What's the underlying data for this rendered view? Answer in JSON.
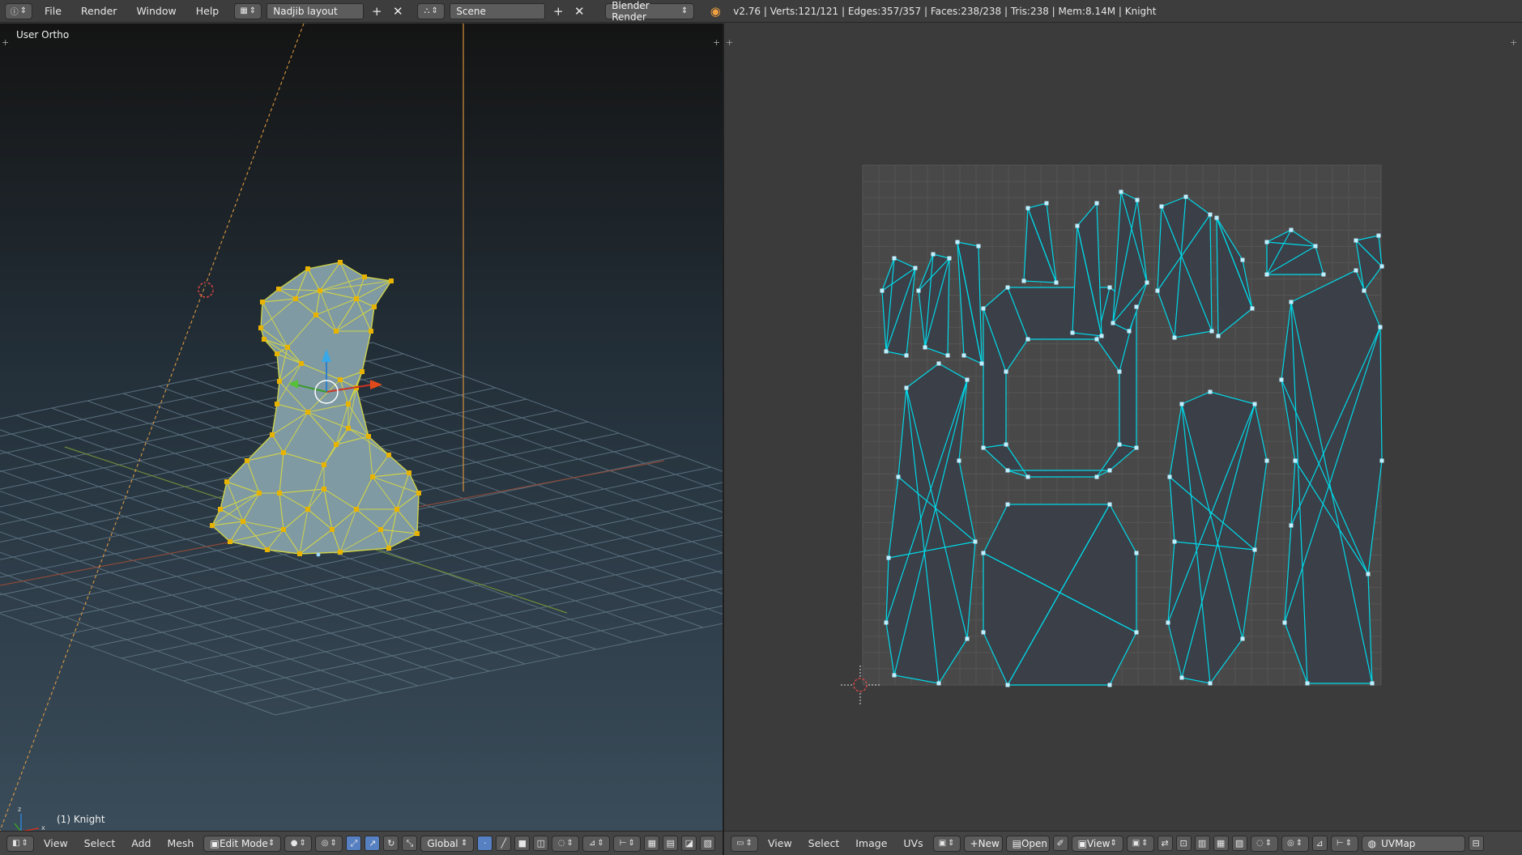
{
  "topbar": {
    "info_icon": "info-icon",
    "menu": [
      "File",
      "Render",
      "Window",
      "Help"
    ],
    "layout_name": "Nadjib layout",
    "scene_name": "Scene",
    "render_engine": "Blender Render",
    "stats": "v2.76 | Verts:121/121 | Edges:357/357 | Faces:238/238 | Tris:238 | Mem:8.14M | Knight"
  },
  "viewport3d": {
    "view_label": "User Ortho",
    "object_label": "(1) Knight",
    "mode": "Edit Mode",
    "orientation": "Global",
    "menu": [
      "View",
      "Select",
      "Add",
      "Mesh"
    ]
  },
  "uv_editor": {
    "menu": [
      "View",
      "Select",
      "Image",
      "UVs"
    ],
    "new_label": "New",
    "open_label": "Open",
    "view_label": "View",
    "uvmap_name": "UVMap"
  },
  "colors": {
    "accent_select": "#5680c2",
    "mesh_vertex": "#e8b300",
    "mesh_edge": "#cfd34a",
    "uv_edge": "#00d9e8",
    "uv_vertex": "#bfefff"
  }
}
